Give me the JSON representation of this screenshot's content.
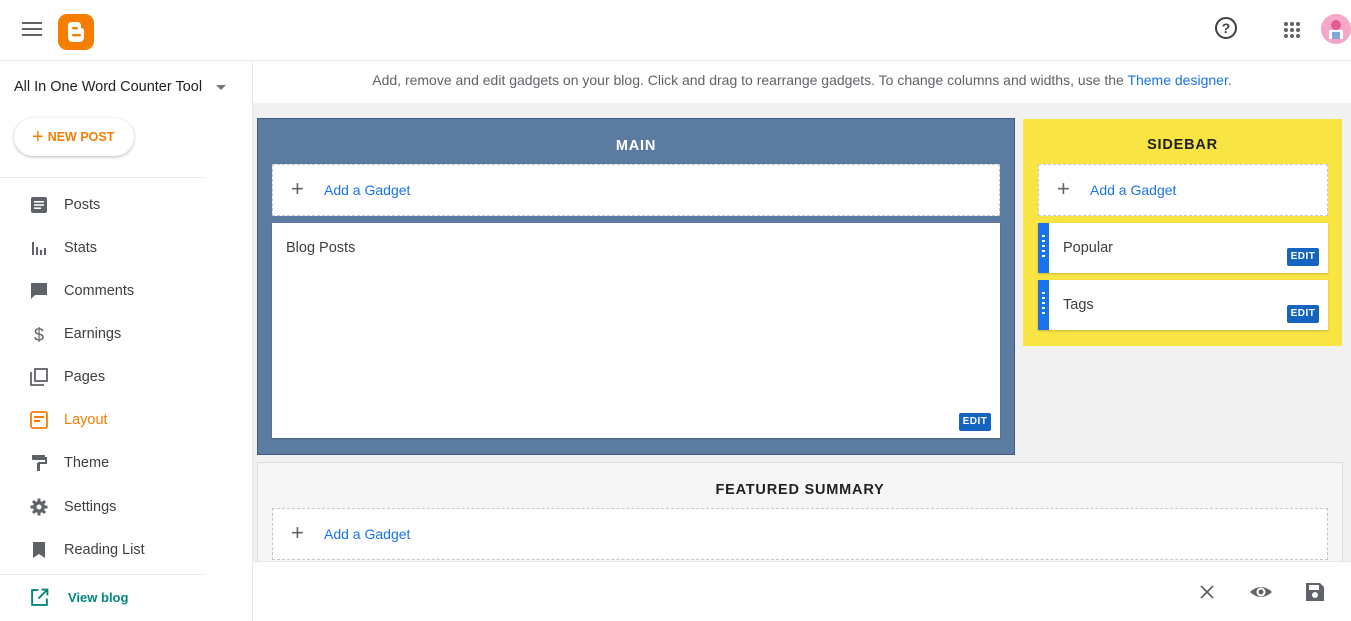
{
  "header": {
    "menu_icon": "hamburger-icon",
    "logo_icon": "blogger-logo-icon",
    "help_icon": "help-icon",
    "help_glyph": "?",
    "apps_icon": "apps-grid-icon",
    "avatar_icon": "avatar"
  },
  "sidebar": {
    "blog_name": "All In One Word Counter Tool",
    "new_post_label": "NEW POST",
    "accent_color": "#f57d00",
    "items": [
      {
        "label": "Posts",
        "icon": "posts-icon",
        "active": false
      },
      {
        "label": "Stats",
        "icon": "stats-icon",
        "active": false
      },
      {
        "label": "Comments",
        "icon": "comments-icon",
        "active": false
      },
      {
        "label": "Earnings",
        "icon": "earnings-icon",
        "active": false
      },
      {
        "label": "Pages",
        "icon": "pages-icon",
        "active": false
      },
      {
        "label": "Layout",
        "icon": "layout-icon",
        "active": true
      },
      {
        "label": "Theme",
        "icon": "theme-icon",
        "active": false
      },
      {
        "label": "Settings",
        "icon": "settings-icon",
        "active": false
      },
      {
        "label": "Reading List",
        "icon": "reading-list-icon",
        "active": false
      }
    ],
    "view_blog_label": "View blog"
  },
  "layout": {
    "info_text": "Add, remove and edit gadgets on your blog. Click and drag to rearrange gadgets. To change columns and widths, use the ",
    "info_link": "Theme designer",
    "info_suffix": ".",
    "main": {
      "title": "MAIN",
      "color": "#5b7ba1",
      "add_gadget": "Add a Gadget",
      "gadgets": [
        {
          "name": "Blog Posts",
          "edit": "EDIT"
        }
      ]
    },
    "sidebar": {
      "title": "SIDEBAR",
      "color": "#f8e443",
      "add_gadget": "Add a Gadget",
      "gadgets": [
        {
          "name": "Popular",
          "edit": "EDIT"
        },
        {
          "name": "Tags",
          "edit": "EDIT"
        }
      ]
    },
    "featured": {
      "title": "FEATURED SUMMARY",
      "add_gadget": "Add a Gadget"
    }
  },
  "bottom": {
    "close_icon": "close-icon",
    "preview_icon": "eye-icon",
    "save_icon": "save-icon"
  }
}
